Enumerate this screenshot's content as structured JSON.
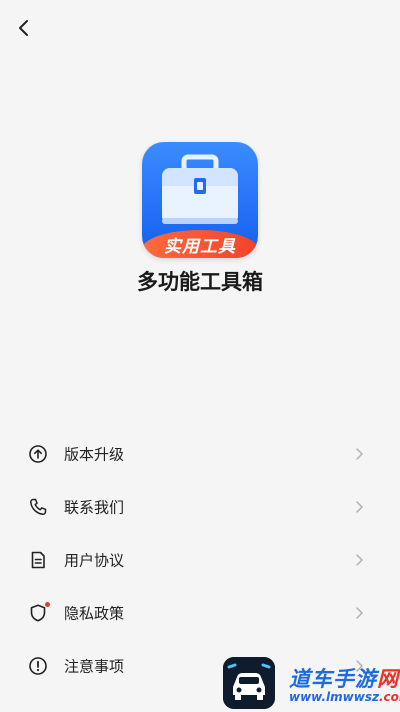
{
  "header": {
    "back_icon": "chevron-left-icon"
  },
  "app": {
    "icon_badge": "实用工具",
    "name": "多功能工具箱",
    "icon_colors": {
      "background": "#2a7bff",
      "ribbon": "#f2432b"
    }
  },
  "menu": {
    "items": [
      {
        "label": "版本升级",
        "icon": "arrow-up-circle-icon"
      },
      {
        "label": "联系我们",
        "icon": "phone-icon"
      },
      {
        "label": "用户协议",
        "icon": "document-icon"
      },
      {
        "label": "隐私政策",
        "icon": "shield-icon",
        "has_dot": true
      },
      {
        "label": "注意事项",
        "icon": "exclamation-circle-icon"
      }
    ]
  },
  "watermark": {
    "title_part1": "道车手游",
    "title_part2": "网",
    "url_part1": "www.lmwwsz",
    "url_part2": ".com"
  }
}
